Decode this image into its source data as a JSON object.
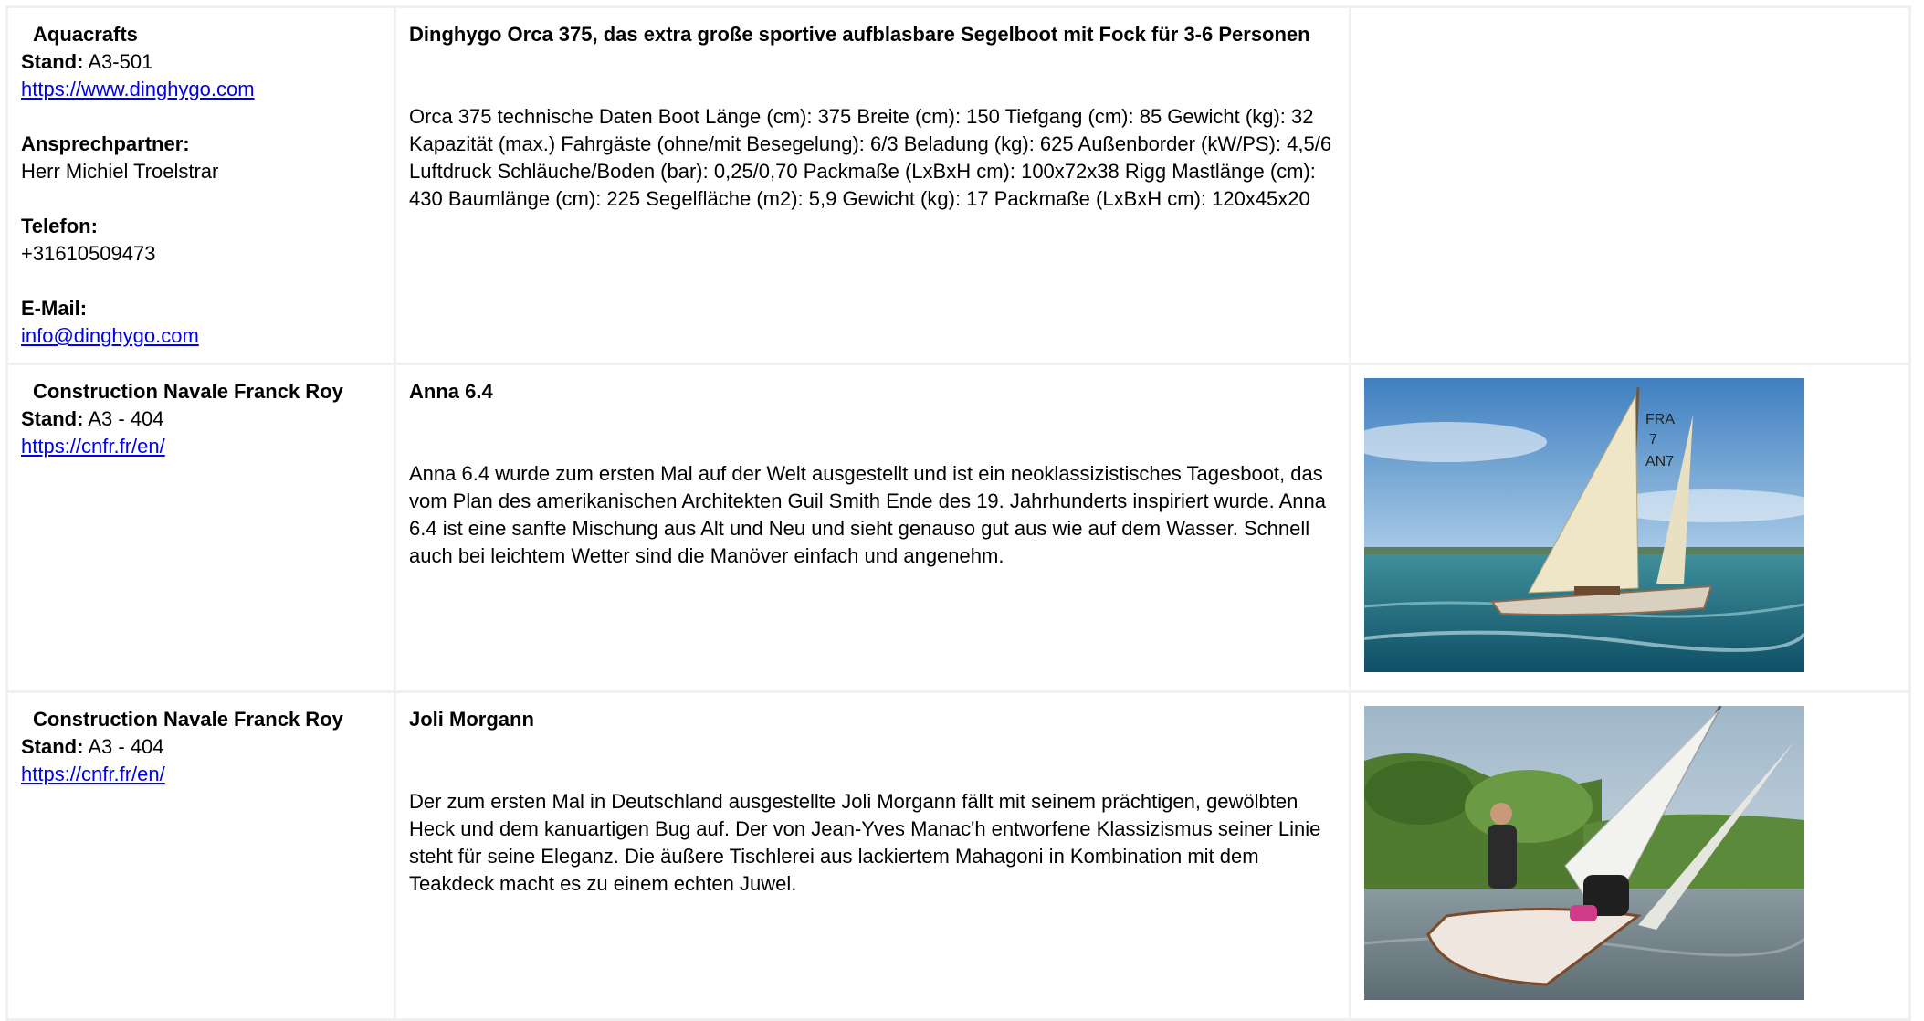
{
  "rows": [
    {
      "exhibitor": {
        "name": "Aquacrafts",
        "stand_label": "Stand:",
        "stand": "A3-501",
        "url": "https://www.dinghygo.com",
        "contact_label": "Ansprechpartner:",
        "contact": "Herr Michiel Troelstrar",
        "phone_label": "Telefon:",
        "phone": "+31610509473",
        "email_label": "E-Mail:",
        "email": "info@dinghygo.com"
      },
      "product": {
        "title": "Dinghygo Orca 375, das extra große sportive aufblasbare Segelboot mit Fock für 3-6 Personen",
        "description": "Orca 375 technische Daten Boot Länge (cm): 375 Breite (cm): 150 Tiefgang (cm): 85 Gewicht (kg): 32 Kapazität (max.) Fahrgäste (ohne/mit Besegelung): 6/3 Beladung (kg): 625 Außenborder (kW/PS): 4,5/6 Luftdruck Schläuche/Boden (bar): 0,25/0,70 Packmaße (LxBxH cm): 100x72x38 Rigg Mastlänge (cm): 430 Baumlänge (cm): 225 Segelfläche (m2): 5,9 Gewicht (kg): 17 Packmaße (LxBxH cm): 120x45x20"
      }
    },
    {
      "exhibitor": {
        "name": "Construction Navale Franck Roy",
        "stand_label": "Stand:",
        "stand": "A3 - 404",
        "url": "https://cnfr.fr/en/"
      },
      "product": {
        "title": "Anna 6.4",
        "description": "Anna 6.4 wurde zum ersten Mal auf der Welt ausgestellt und ist ein neoklassizistisches Tagesboot, das vom Plan des amerikanischen Architekten Guil Smith Ende des 19. Jahrhunderts inspiriert wurde. Anna 6.4 ist eine sanfte Mischung aus Alt und Neu und sieht genauso gut aus wie auf dem Wasser. Schnell auch bei leichtem Wetter sind die Manöver einfach und angenehm."
      },
      "image": {
        "sail_text": "FRA 7 AN7"
      }
    },
    {
      "exhibitor": {
        "name": "Construction Navale Franck Roy",
        "stand_label": "Stand:",
        "stand": "A3 - 404",
        "url": "https://cnfr.fr/en/"
      },
      "product": {
        "title": "Joli Morgann",
        "description": "Der zum ersten Mal in Deutschland ausgestellte Joli Morgann fällt mit seinem prächtigen, gewölbten Heck und dem kanuartigen Bug auf. Der von Jean-Yves Manac'h entworfene Klassizismus seiner Linie steht für seine Eleganz. Die äußere Tischlerei aus lackiertem Mahagoni in Kombination mit dem Teakdeck macht es zu einem echten Juwel."
      }
    }
  ]
}
